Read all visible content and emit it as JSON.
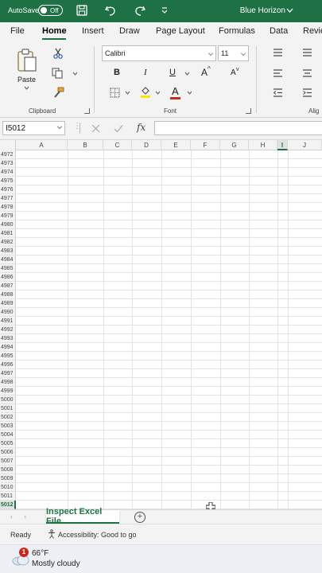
{
  "titlebar": {
    "autosave_label": "AutoSave",
    "autosave_state": "Off",
    "user_name": "Blue Horizon",
    "accent": "#1e7145"
  },
  "tabs": [
    "File",
    "Home",
    "Insert",
    "Draw",
    "Page Layout",
    "Formulas",
    "Data",
    "Revie"
  ],
  "active_tab": "Home",
  "ribbon": {
    "clipboard": {
      "paste_label": "Paste",
      "group_label": "Clipboard"
    },
    "font": {
      "font_name": "Calibri",
      "font_size": "11",
      "bold": "B",
      "italic": "I",
      "underline": "U",
      "grow": "A",
      "shrink": "A",
      "color_letter": "A",
      "group_label": "Font",
      "font_color": "#c42b1c",
      "highlight_color": "#ffe600"
    },
    "alignment": {
      "group_label": "Alig"
    }
  },
  "formula_bar": {
    "name_box": "I5012",
    "fx_label": "fx",
    "formula": ""
  },
  "columns": [
    "A",
    "B",
    "C",
    "D",
    "E",
    "F",
    "G",
    "H",
    "I",
    "J"
  ],
  "selected_column": "I",
  "rows": [
    "4972",
    "4973",
    "4974",
    "4975",
    "4976",
    "4977",
    "4978",
    "4979",
    "4980",
    "4981",
    "4982",
    "4983",
    "4984",
    "4985",
    "4986",
    "4987",
    "4988",
    "4989",
    "4990",
    "4991",
    "4992",
    "4993",
    "4994",
    "4995",
    "4996",
    "4997",
    "4998",
    "4999",
    "5000",
    "5001",
    "5002",
    "5003",
    "5004",
    "5005",
    "5006",
    "5007",
    "5008",
    "5009",
    "5010",
    "5011",
    "5012"
  ],
  "selected_row": "5012",
  "sheet_tabs": [
    "Inspect Excel File"
  ],
  "status": {
    "ready": "Ready",
    "accessibility": "Accessibility: Good to go"
  },
  "taskbar": {
    "badge_count": "1",
    "temperature": "66°F",
    "condition": "Mostly cloudy"
  }
}
